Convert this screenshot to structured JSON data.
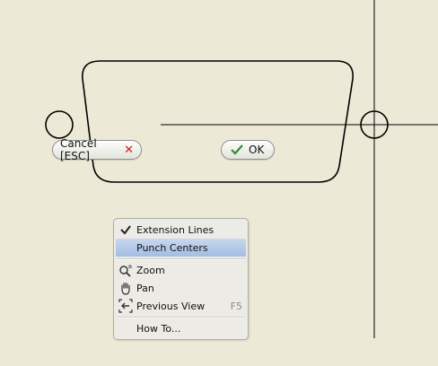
{
  "dialog": {
    "cancel_label": "Cancel [ESC]",
    "ok_label": "OK"
  },
  "context_menu": {
    "items": [
      {
        "label": "Extension Lines",
        "checked": true,
        "highlighted": false,
        "icon": "check-icon",
        "shortcut": ""
      },
      {
        "label": "Punch Centers",
        "checked": false,
        "highlighted": true,
        "icon": "",
        "shortcut": ""
      },
      {
        "label": "Zoom",
        "checked": false,
        "highlighted": false,
        "icon": "zoom-icon",
        "shortcut": ""
      },
      {
        "label": "Pan",
        "checked": false,
        "highlighted": false,
        "icon": "pan-hand-icon",
        "shortcut": ""
      },
      {
        "label": "Previous View",
        "checked": false,
        "highlighted": false,
        "icon": "previous-view-icon",
        "shortcut": "F5"
      },
      {
        "label": "How To...",
        "checked": false,
        "highlighted": false,
        "icon": "",
        "shortcut": ""
      }
    ]
  },
  "colors": {
    "background": "#ecead6",
    "sketch_line": "#000000",
    "cancel_icon": "#c81e1e",
    "ok_icon": "#2e8b2e",
    "menu_highlight": "#a3bde2"
  }
}
